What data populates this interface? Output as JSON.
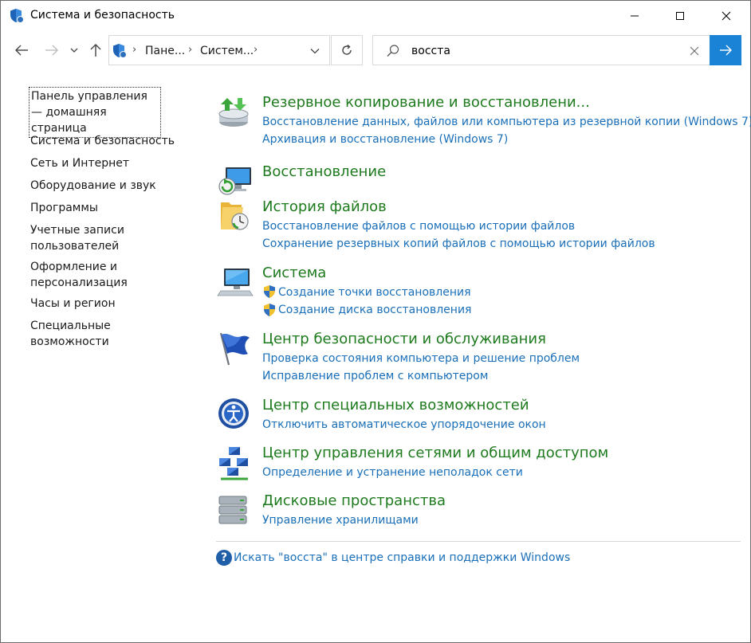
{
  "window": {
    "title": "Система и безопасность"
  },
  "address": {
    "crumbs": [
      "Пане...",
      "Систем..."
    ]
  },
  "search": {
    "value": "восста"
  },
  "sidebar": {
    "home": "Панель управления — домашняя страница",
    "items": [
      {
        "label": "Система и безопасность"
      },
      {
        "label": "Сеть и Интернет"
      },
      {
        "label": "Оборудование и звук"
      },
      {
        "label": "Программы"
      },
      {
        "label": "Учетные записи пользователей"
      },
      {
        "label": "Оформление и персонализация"
      },
      {
        "label": "Часы и регион"
      },
      {
        "label": "Специальные возможности"
      }
    ]
  },
  "sections": [
    {
      "heading": "Резервное копирование и восстановлени...",
      "links": [
        "Восстановление данных, файлов или компьютера из резервной копии (Windows 7)",
        "Архивация и восстановление (Windows 7)"
      ]
    },
    {
      "heading": "Восстановление",
      "links": []
    },
    {
      "heading": "История файлов",
      "links": [
        "Восстановление файлов с помощью истории файлов",
        "Сохранение резервных копий файлов с помощью истории файлов"
      ]
    },
    {
      "heading": "Система",
      "links": [
        "Создание точки восстановления",
        "Создание диска восстановления"
      ]
    },
    {
      "heading": "Центр безопасности и обслуживания",
      "links": [
        "Проверка состояния компьютера и решение проблем",
        "Исправление проблем с компьютером"
      ]
    },
    {
      "heading": "Центр специальных возможностей",
      "links": [
        "Отключить автоматическое упорядочение окон"
      ]
    },
    {
      "heading": "Центр управления сетями и общим доступом",
      "links": [
        "Определение и устранение неполадок сети"
      ]
    },
    {
      "heading": "Дисковые пространства",
      "links": [
        "Управление хранилищами"
      ]
    }
  ],
  "help": {
    "text": "Искать \"восста\" в центре справки и поддержки Windows"
  },
  "colors": {
    "heading_green": "#1d7a1d",
    "link_blue": "#1a6fb8",
    "accent_blue": "#1a83d6"
  }
}
